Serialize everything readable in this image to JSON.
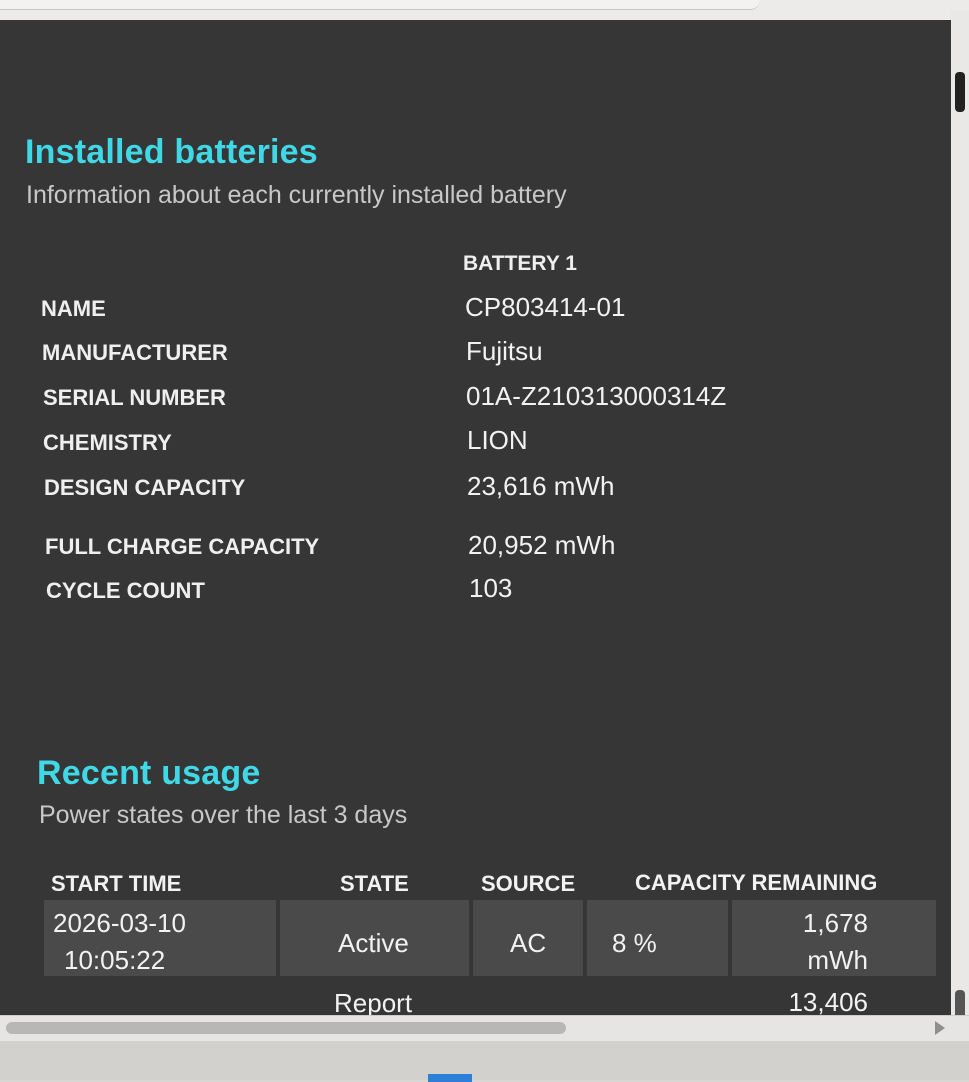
{
  "installed": {
    "title": "Installed batteries",
    "subtitle": "Information about each currently installed battery",
    "battery_header": "BATTERY 1",
    "rows": [
      {
        "label": "NAME",
        "value": "CP803414-01"
      },
      {
        "label": "MANUFACTURER",
        "value": "Fujitsu"
      },
      {
        "label": "SERIAL NUMBER",
        "value": "01A-Z210313000314Z"
      },
      {
        "label": "CHEMISTRY",
        "value": "LION"
      },
      {
        "label": "DESIGN CAPACITY",
        "value": "23,616 mWh"
      },
      {
        "label": "FULL CHARGE CAPACITY",
        "value": "20,952 mWh"
      },
      {
        "label": "CYCLE COUNT",
        "value": "103"
      }
    ]
  },
  "usage": {
    "title": "Recent usage",
    "subtitle": "Power states over the last 3 days",
    "columns": [
      "START TIME",
      "STATE",
      "SOURCE",
      "CAPACITY REMAINING"
    ],
    "rows": [
      {
        "date": "2026-03-10",
        "time": "10:05:22",
        "state": "Active",
        "source": "AC",
        "percent": "8 %",
        "mwh_value": "1,678",
        "mwh_unit": "mWh"
      },
      {
        "state": "Report",
        "mwh_value": "13,406"
      }
    ]
  }
}
